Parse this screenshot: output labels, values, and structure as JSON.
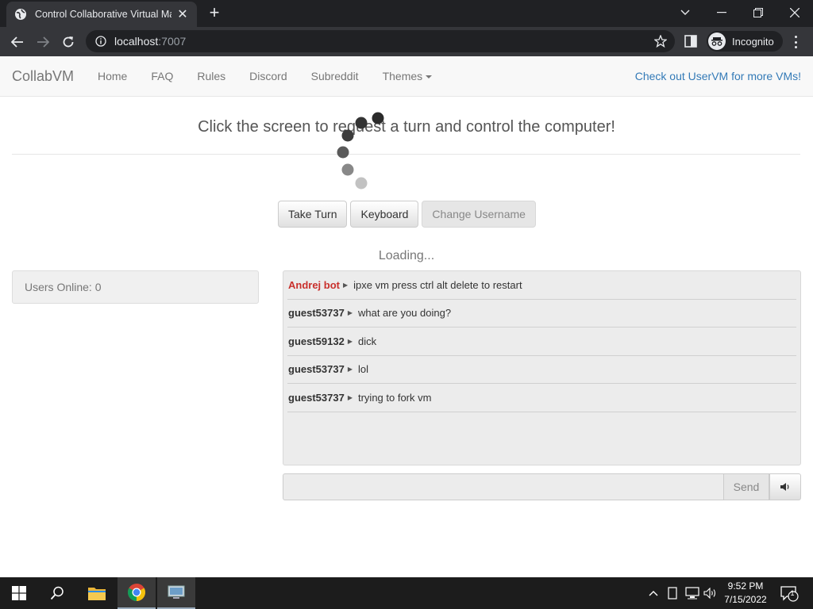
{
  "browser": {
    "tab_title": "Control Collaborative Virtual Mac",
    "url_host": "localhost",
    "url_port": ":7007",
    "incognito_label": "Incognito"
  },
  "navbar": {
    "brand": "CollabVM",
    "links": [
      "Home",
      "FAQ",
      "Rules",
      "Discord",
      "Subreddit",
      "Themes"
    ],
    "right_link": "Check out UserVM for more VMs!"
  },
  "main": {
    "headline": "Click the screen to request a turn and control the computer!",
    "buttons": {
      "take_turn": "Take Turn",
      "keyboard": "Keyboard",
      "change_username": "Change Username"
    },
    "loading_text": "Loading...",
    "users_online": "Users Online: 0"
  },
  "chat": {
    "messages": [
      {
        "user": "Andrej bot",
        "text": "ipxe vm press ctrl alt delete to restart",
        "is_bot": true
      },
      {
        "user": "guest53737",
        "text": "what are you doing?",
        "is_bot": false
      },
      {
        "user": "guest59132",
        "text": "dick",
        "is_bot": false
      },
      {
        "user": "guest53737",
        "text": "lol",
        "is_bot": false
      },
      {
        "user": "guest53737",
        "text": "trying to fork vm",
        "is_bot": false
      }
    ],
    "send_label": "Send",
    "input_value": ""
  },
  "taskbar": {
    "time": "9:52 PM",
    "date": "7/15/2022",
    "notification_count": "1"
  },
  "colors": {
    "bot_name": "#c9302c",
    "link": "#337ab7",
    "chrome_dark": "#202124"
  }
}
